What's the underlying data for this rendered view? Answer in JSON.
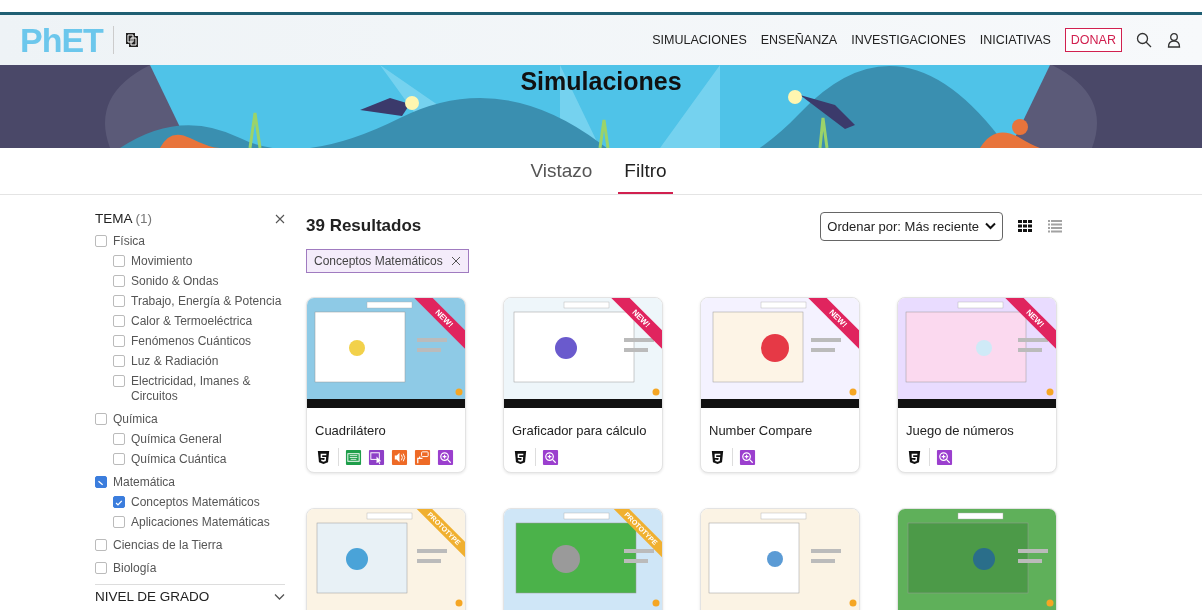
{
  "header": {
    "logo_text": "PhET",
    "nav": [
      {
        "label": "SIMULACIONES"
      },
      {
        "label": "ENSEÑANZA"
      },
      {
        "label": "INVESTIGACIONES"
      },
      {
        "label": "INICIATIVAS"
      }
    ],
    "donate": "DONAR"
  },
  "banner": {
    "title": "Simulaciones",
    "kind": "picture"
  },
  "view_tabs": [
    {
      "label": "Vistazo",
      "selected": false
    },
    {
      "label": "Filtro",
      "selected": true
    }
  ],
  "filter": {
    "title": "TEMA",
    "count": "(1)",
    "topics": [
      {
        "label": "Física",
        "checked": false,
        "indeterminate": false,
        "children": [
          {
            "label": "Movimiento",
            "checked": false
          },
          {
            "label": "Sonido & Ondas",
            "checked": false
          },
          {
            "label": "Trabajo, Energía & Potencia",
            "checked": false
          },
          {
            "label": "Calor & Termoeléctrica",
            "checked": false
          },
          {
            "label": "Fenómenos Cuánticos",
            "checked": false
          },
          {
            "label": "Luz & Radiación",
            "checked": false
          },
          {
            "label": "Electricidad, Imanes & Circuitos",
            "checked": false
          }
        ]
      },
      {
        "label": "Química",
        "checked": false,
        "indeterminate": false,
        "children": [
          {
            "label": "Química General",
            "checked": false
          },
          {
            "label": "Química Cuántica",
            "checked": false
          }
        ]
      },
      {
        "label": "Matemática",
        "checked": false,
        "indeterminate": true,
        "children": [
          {
            "label": "Conceptos Matemáticos",
            "checked": true
          },
          {
            "label": "Aplicaciones Matemáticas",
            "checked": false
          }
        ]
      },
      {
        "label": "Ciencias de la Tierra",
        "checked": false,
        "indeterminate": false
      },
      {
        "label": "Biología",
        "checked": false,
        "indeterminate": false
      }
    ],
    "next_section": "NIVEL DE GRADO"
  },
  "results": {
    "count": "39 Resultados",
    "chips": [
      {
        "label": "Conceptos Matemáticos"
      }
    ],
    "sort": "Ordenar por: Más reciente",
    "views": [
      {
        "kind": "grid",
        "selected": true
      },
      {
        "kind": "list",
        "selected": false
      }
    ]
  },
  "cards": [
    {
      "title": "Cuadrilátero",
      "ribbon": {
        "kind": "new",
        "text": "NEW!"
      },
      "features": [
        {
          "kind": "html5"
        },
        {
          "kind": "keyboard"
        },
        {
          "kind": "interactive"
        },
        {
          "kind": "sound"
        },
        {
          "kind": "voicing"
        },
        {
          "kind": "zoom"
        }
      ]
    },
    {
      "title": "Graficador para cálculo",
      "ribbon": {
        "kind": "new",
        "text": "NEW!"
      },
      "features": [
        {
          "kind": "html5"
        },
        {
          "kind": "zoom"
        }
      ]
    },
    {
      "title": "Number Compare",
      "ribbon": {
        "kind": "new",
        "text": "NEW!"
      },
      "features": [
        {
          "kind": "html5"
        },
        {
          "kind": "zoom"
        }
      ]
    },
    {
      "title": "Juego de números",
      "ribbon": {
        "kind": "new",
        "text": "NEW!"
      },
      "features": [
        {
          "kind": "html5"
        },
        {
          "kind": "zoom"
        }
      ]
    },
    {
      "kind": "picture",
      "ribbon": {
        "kind": "prototype",
        "text": "PROTOTYPE"
      }
    },
    {
      "kind": "picture",
      "ribbon": {
        "kind": "prototype",
        "text": "PROTOTYPE"
      }
    },
    {
      "kind": "picture"
    },
    {
      "kind": "picture"
    }
  ]
}
